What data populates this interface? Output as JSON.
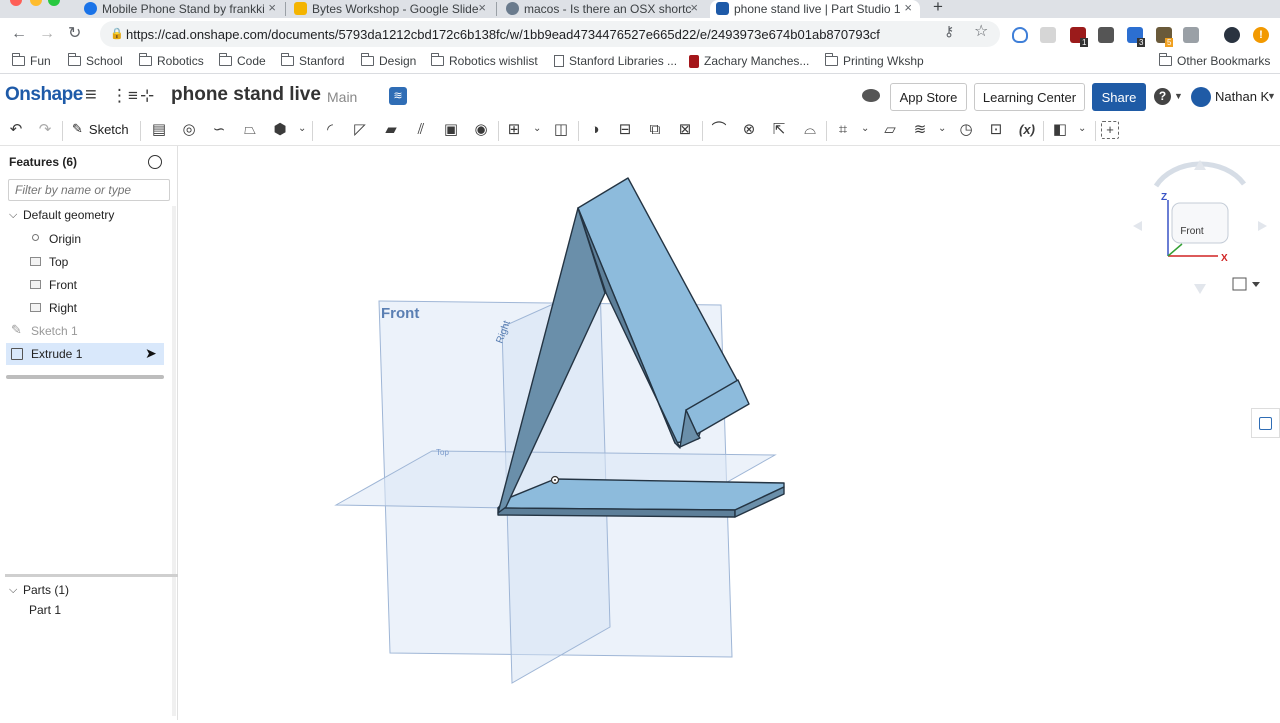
{
  "browser": {
    "tabs": [
      {
        "title": "Mobile Phone Stand by frankki",
        "fav_color": "#1a73e8"
      },
      {
        "title": "Bytes Workshop - Google Slide",
        "fav_color": "#f4b400"
      },
      {
        "title": "macos - Is there an OSX shortc",
        "fav_color": "#6a7b8d"
      },
      {
        "title": "phone stand live | Part Studio 1",
        "fav_color": "#1e5aa8"
      }
    ],
    "new_tab": "+",
    "close_glyph": "×",
    "url": "https://cad.onshape.com/documents/5793da1212cbd172c6b138fc/w/1bb9ead4734476527e665d22/e/2493973e674b01ab870793cf",
    "bookmarks": [
      "Fun",
      "School",
      "Robotics",
      "Code",
      "Stanford",
      "Design",
      "Robotics wishlist",
      "Stanford Libraries ...",
      "Zachary Manches...",
      "Printing Wkshp"
    ],
    "other_bookmarks": "Other Bookmarks",
    "ext_badges": [
      "1",
      "3",
      "5"
    ]
  },
  "onshape": {
    "logo": "Onshape",
    "doc_title": "phone stand live",
    "branch": "Main",
    "app_store": "App Store",
    "learning_center": "Learning Center",
    "share": "Share",
    "help": "?",
    "user": "Nathan K",
    "sketch_label": "Sketch",
    "fx_label": "(x)"
  },
  "features": {
    "title": "Features (6)",
    "filter_placeholder": "Filter by name or type",
    "default_geometry": "Default geometry",
    "items": [
      "Origin",
      "Top",
      "Front",
      "Right"
    ],
    "sketch": "Sketch 1",
    "extrude": "Extrude 1"
  },
  "parts": {
    "title": "Parts (1)",
    "items": [
      "Part 1"
    ]
  },
  "viewport": {
    "front_label": "Front",
    "right_label": "Right",
    "top_label": "Top",
    "viewcube_face": "Front",
    "axis_z": "Z",
    "axis_x": "X"
  },
  "colors": {
    "part_light": "#8dbbdc",
    "part_dark": "#6a8faa",
    "plane": "#dce7f5",
    "accent": "#1f5ba6",
    "selection": "#d9e8fb"
  }
}
